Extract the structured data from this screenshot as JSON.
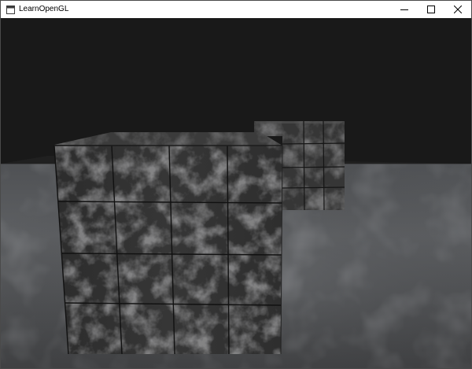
{
  "window": {
    "title": "LearnOpenGL",
    "icon": "window-app-icon",
    "controls": [
      {
        "name": "minimize",
        "icon": "minimize-icon"
      },
      {
        "name": "maximize",
        "icon": "maximize-icon"
      },
      {
        "name": "close",
        "icon": "close-icon"
      }
    ]
  },
  "scene": {
    "clear_color": "#191919",
    "floor_color": "#5a5c5f",
    "cube_color": "#3a3a3a",
    "objects": [
      "floor-plane",
      "front-marble-cube",
      "back-marble-cube"
    ]
  }
}
